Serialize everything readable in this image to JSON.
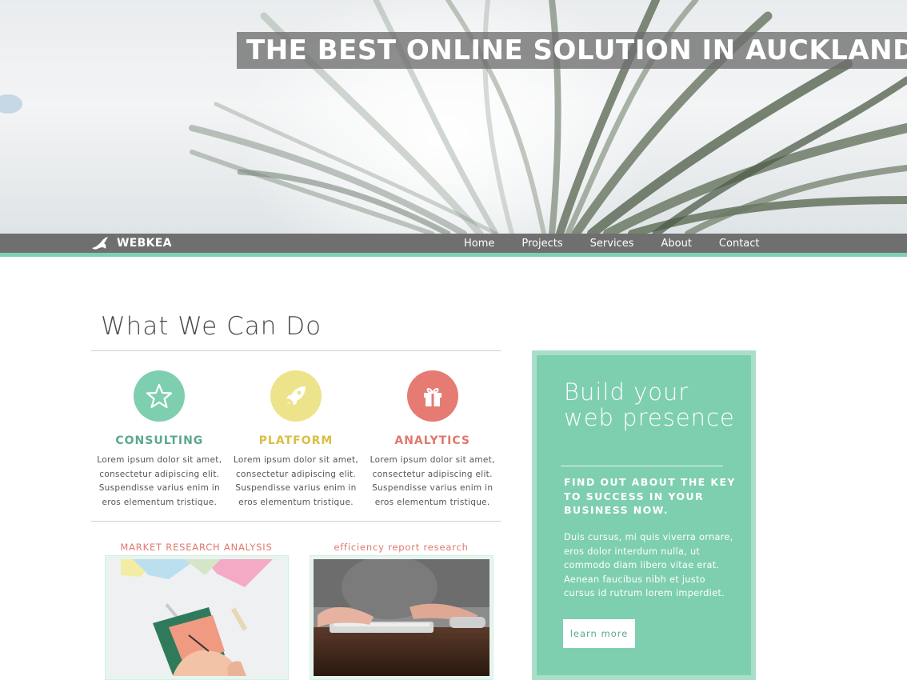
{
  "hero": {
    "title": "THE BEST ONLINE SOLUTION IN AUCKLAND."
  },
  "nav": {
    "brand": "WEBKEA",
    "brand_icon": "kea-bird-icon",
    "links": [
      "Home",
      "Projects",
      "Services",
      "About",
      "Contact"
    ]
  },
  "main": {
    "title": "What We Can Do",
    "features": [
      {
        "title": "CONSULTING",
        "icon": "star-icon",
        "color": "#7ecfb0",
        "title_color": "#5ba88c",
        "text": "Lorem ipsum dolor sit amet, consectetur adipiscing elit. Suspendisse varius enim in eros elementum tristique."
      },
      {
        "title": "PLATFORM",
        "icon": "rocket-icon",
        "color": "#ede38a",
        "title_color": "#d9bf45",
        "text": "Lorem ipsum dolor sit amet, consectetur adipiscing elit. Suspendisse varius enim in eros elementum tristique."
      },
      {
        "title": "ANALYTICS",
        "icon": "gift-icon",
        "color": "#e57b72",
        "title_color": "#e0786c",
        "text": "Lorem ipsum dolor sit amet, consectetur adipiscing elit. Suspendisse varius enim in eros elementum tristique."
      }
    ],
    "thumbnails": [
      {
        "label": "MARKET RESEARCH ANALYSIS"
      },
      {
        "label": "efficiency report research"
      }
    ]
  },
  "cta": {
    "heading": "Build your web presence",
    "subheading": "FIND OUT ABOUT THE KEY TO SUCCESS IN YOUR BUSINESS NOW.",
    "body": "Duis cursus, mi quis viverra ornare, eros dolor interdum nulla, ut commodo diam libero vitae erat. Aenean faucibus nibh et justo cursus id rutrum lorem imperdiet.",
    "button": "learn more"
  },
  "colors": {
    "accent": "#7ecfb0",
    "nav_bg": "#6f6f6f",
    "label_red": "#e0786c"
  }
}
